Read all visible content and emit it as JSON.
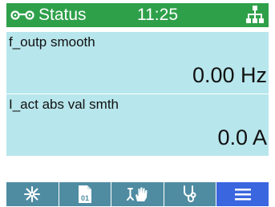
{
  "header": {
    "title": "Status",
    "time": "11:25",
    "left_icon": "glasses-icon",
    "right_icon": "network-icon",
    "color": "#2fa04a"
  },
  "parameters": [
    {
      "label": "f_outp smooth",
      "value": "0.00 Hz"
    },
    {
      "label": "I_act abs val smth",
      "value": "0.0 A"
    }
  ],
  "softkeys": [
    {
      "icon": "asterisk-icon",
      "active": false
    },
    {
      "icon": "parameter-list-icon",
      "label": "01",
      "active": false
    },
    {
      "icon": "manual-control-icon",
      "active": false
    },
    {
      "icon": "stethoscope-icon",
      "active": false
    },
    {
      "icon": "menu-icon",
      "active": true
    }
  ],
  "colors": {
    "panel": "#b7e6ec",
    "softkey": "#4f8ca2",
    "softkey_active": "#3a66e0"
  }
}
